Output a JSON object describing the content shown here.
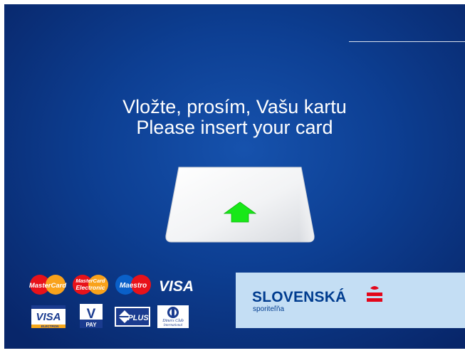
{
  "prompt": {
    "line_sk": "Vložte, prosím, Vašu kartu",
    "line_en": "Please insert your card"
  },
  "card_icon": {
    "icon": "insert-card-arrow-icon",
    "arrow_color": "#18e818"
  },
  "payment_logos": {
    "mastercard": "MasterCard",
    "mastercard_electronic_1": "MasterCard",
    "mastercard_electronic_2": "Electronic",
    "maestro": "Maestro",
    "visa": "VISA",
    "visa_electron_main": "VISA",
    "visa_electron_sub": "ELECTRON",
    "vpay_main": "V",
    "vpay_sub": "PAY",
    "plus": "PLUS",
    "diners_line1": "Diners Club",
    "diners_line2": "International"
  },
  "bank": {
    "name": "SLOVENSKÁ",
    "subname": "sporiteľňa",
    "brand_color": "#003c8f",
    "accent_color": "#e3061a"
  },
  "colors": {
    "background": "#0d3f93",
    "panel": "#c4def4"
  }
}
